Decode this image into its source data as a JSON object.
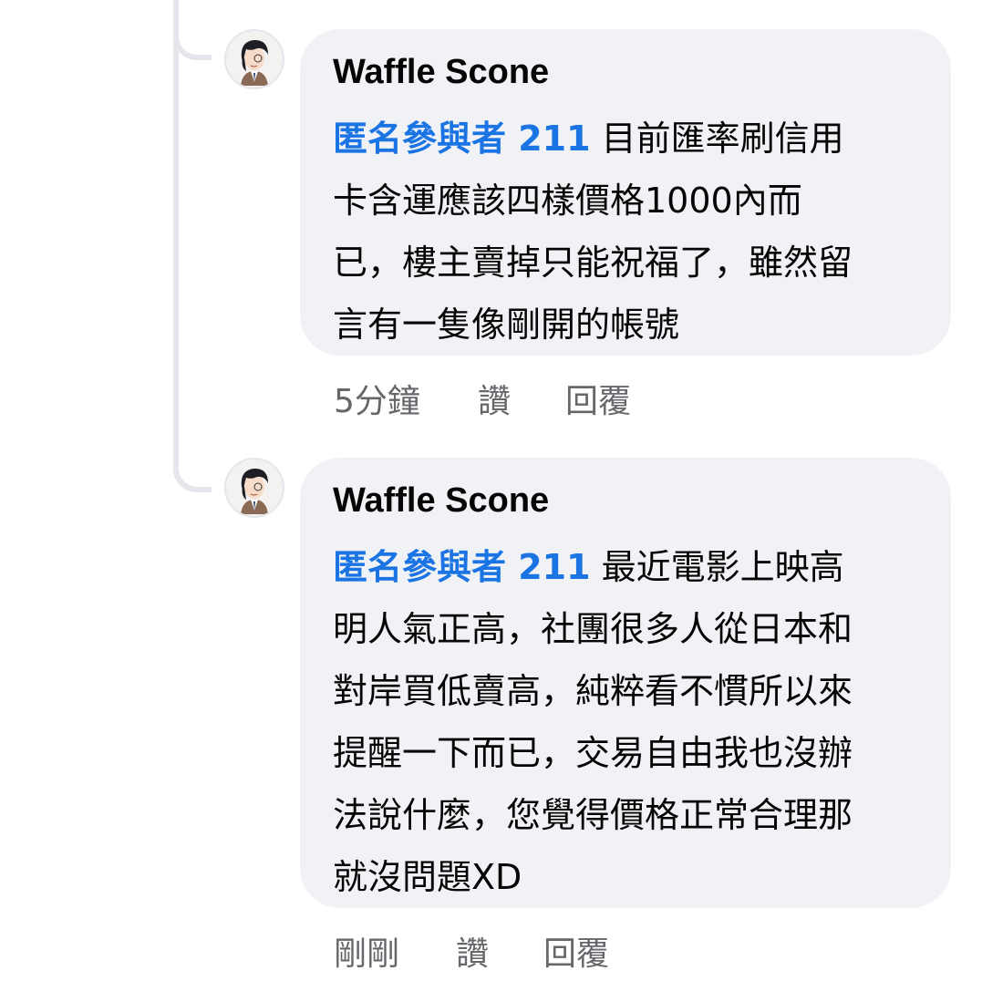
{
  "comments": [
    {
      "author": "Waffle Scone",
      "mention": "匿名參與者 211",
      "text_lines": [
        " 目前匯率刷信用",
        "卡含運應該四樣價格1000內而",
        "已，樓主賣掉只能祝福了，雖然留",
        "言有一隻像剛開的帳號"
      ],
      "time": "5分鐘",
      "like_label": "讚",
      "reply_label": "回覆"
    },
    {
      "author": "Waffle Scone",
      "mention": "匿名參與者 211",
      "text_lines": [
        " 最近電影上映高",
        "明人氣正高，社團很多人從日本和",
        "對岸買低賣高，純粹看不慣所以來",
        "提醒一下而已，交易自由我也沒辦",
        "法說什麼，您覺得價格正常合理那",
        "就沒問題XD"
      ],
      "time": "剛剛",
      "like_label": "讚",
      "reply_label": "回覆"
    }
  ],
  "colors": {
    "mention": "#1b74e4",
    "bubble": "#f0f2f5",
    "meta": "#65676b",
    "thread_line": "#e4e6eb"
  },
  "icons": [
    "avatar-icon"
  ]
}
